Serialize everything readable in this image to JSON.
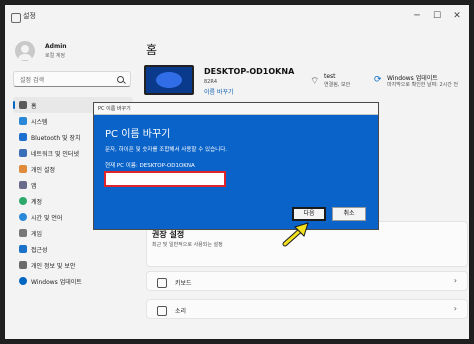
{
  "window": {
    "title": "설정"
  },
  "profile": {
    "name": "Admin",
    "account_type": "로컬 계정"
  },
  "search": {
    "placeholder": "설정 검색"
  },
  "sidebar": {
    "items": [
      {
        "label": "홈",
        "active": true
      },
      {
        "label": "시스템"
      },
      {
        "label": "Bluetooth 및 장치"
      },
      {
        "label": "네트워크 및 인터넷"
      },
      {
        "label": "개인 설정"
      },
      {
        "label": "앱"
      },
      {
        "label": "계정"
      },
      {
        "label": "시간 및 언어"
      },
      {
        "label": "게임"
      },
      {
        "label": "접근성"
      },
      {
        "label": "개인 정보 및 보안"
      },
      {
        "label": "Windows 업데이트"
      }
    ]
  },
  "main": {
    "title": "홈",
    "pc_name": "DESKTOP-OD1OKNA",
    "pc_model": "82R4",
    "rename_link": "이름 바꾸기",
    "wifi": {
      "name": "test",
      "status": "연결됨, 보안"
    },
    "windows_update": {
      "title": "Windows 업데이트",
      "status": "마지막으로 확인한 날짜: 2시간 전"
    },
    "recommended": {
      "title": "권장 설정",
      "subtitle": "최근 및 일반적으로 사용되는 설정"
    },
    "rows": [
      {
        "label": "키보드"
      },
      {
        "label": "소리"
      }
    ]
  },
  "dialog": {
    "title": "PC 이름 바꾸기",
    "heading": "PC 이름 바꾸기",
    "description": "문자, 하이픈 및 숫자를 조합해서 사용할 수 있습니다.",
    "current_name": "현재 PC 이름: DESKTOP-OD1OKNA",
    "input_value": "",
    "next_label": "다음",
    "cancel_label": "취소"
  },
  "colors": {
    "accent": "#0067c0",
    "dialog_bg": "#0a63c9",
    "highlight_box": "#e0242b",
    "arrow": "#f0e020"
  },
  "icons": {
    "titlebar": [
      "minimize-icon",
      "maximize-icon",
      "close-icon"
    ],
    "wifi": "wifi-icon",
    "windows_update": "refresh-icon"
  }
}
